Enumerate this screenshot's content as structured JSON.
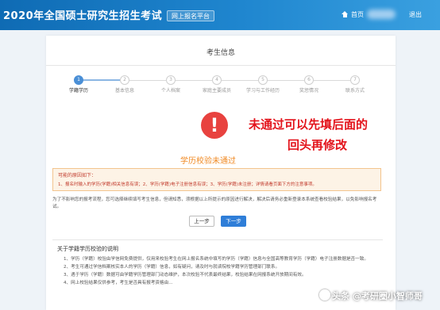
{
  "header": {
    "title": "2020年全国硕士研究生招生考试",
    "subtitle": "网上报名平台",
    "home_label": "首页",
    "exit_label": "退出"
  },
  "page": {
    "title": "考生信息"
  },
  "steps": [
    {
      "number": "1",
      "label": "学籍学历",
      "active": true
    },
    {
      "number": "2",
      "label": "基本信息",
      "active": false
    },
    {
      "number": "3",
      "label": "个人档案",
      "active": false
    },
    {
      "number": "4",
      "label": "家庭主要成员",
      "active": false
    },
    {
      "number": "5",
      "label": "学习与工作经历",
      "active": false
    },
    {
      "number": "6",
      "label": "奖惩情况",
      "active": false
    },
    {
      "number": "7",
      "label": "联系方式",
      "active": false
    }
  ],
  "annotation": {
    "line1": "未通过可以先填后面的",
    "line2": "回头再修改"
  },
  "status": {
    "title": "学历校验未通过",
    "icon": "exclamation-icon"
  },
  "reasons": {
    "heading": "可能的原因如下：",
    "text": "1、报名时输入的学历(学籍)相关信息有误；2、学历(学籍)电子注册信息有误；3、学历(学籍)未注册；详情请看页面下方的注意事项。"
  },
  "notice": "为了不影响您的报考流程，您可选择继续填写考生信息，但请知悉，须根据以上所提示的原因进行解决，解决后请务必重新登录本系统查看校验结果，以免影响报名考试。",
  "buttons": {
    "prev": "上一步",
    "next": "下一步"
  },
  "info": {
    "title": "关于学籍学历校验的说明",
    "items": [
      "1、学历（学籍）校验由学信网免费提供，仅用来校验考生在网上报名系统中填写的学历（学籍）信息与全国高等教育学历（学籍）电子注册数据是否一致。",
      "2、考生可通过学信档案核实本人的学历（学籍）信息，如有疑问，请及时与就读院校学籍学历管理部门联系。",
      "3、遇于学历（学籍）数据可由学籍学历管理部门动态维护，本次校验不代表最终结果，校验结果在网报系统开放期间有效。",
      "4、网上校验结果仅供参考，考生是否具有报考资格由..."
    ]
  },
  "watermark": "头条 @考研圈小智师哥",
  "colors": {
    "header": "#1a7cc6",
    "accent": "#2f7ed8",
    "alert": "#e8423f",
    "annotation": "#e3131b",
    "warning": "#f08a24"
  }
}
